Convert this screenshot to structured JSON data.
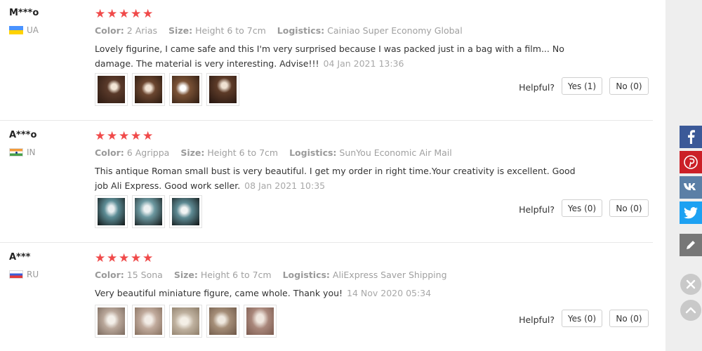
{
  "reviews": [
    {
      "user": "M***o",
      "country": "UA",
      "rating": 5,
      "color_label": "Color:",
      "color": "2 Arias",
      "size_label": "Size:",
      "size": "Height 6 to 7cm",
      "logistics_label": "Logistics:",
      "logistics": "Cainiao Super Economy Global",
      "text": "Lovely figurine, I came safe and this I'm very surprised because I was packed just in a bag with a film... No damage. The material is very interesting. Advise!!!",
      "date": "04 Jan 2021 13:36",
      "photos": 4,
      "helpful_label": "Helpful?",
      "yes": "Yes (1)",
      "no": "No (0)"
    },
    {
      "user": "A***o",
      "country": "IN",
      "rating": 5,
      "color_label": "Color:",
      "color": "6 Agrippa",
      "size_label": "Size:",
      "size": "Height 6 to 7cm",
      "logistics_label": "Logistics:",
      "logistics": "SunYou Economic Air Mail",
      "text": "This antique Roman small bust is very beautiful. I get my order in right time.Your creativity is excellent. Good job Ali Express. Good work seller.",
      "date": "08 Jan 2021 10:35",
      "photos": 3,
      "helpful_label": "Helpful?",
      "yes": "Yes (0)",
      "no": "No (0)"
    },
    {
      "user": "A***",
      "country": "RU",
      "rating": 5,
      "color_label": "Color:",
      "color": "15 Sona",
      "size_label": "Size:",
      "size": "Height 6 to 7cm",
      "logistics_label": "Logistics:",
      "logistics": "AliExpress Saver Shipping",
      "text": "Very beautiful miniature figure, came whole. Thank you!",
      "date": "14 Nov 2020 05:34",
      "photos": 5,
      "helpful_label": "Helpful?",
      "yes": "Yes (0)",
      "no": "No (0)"
    }
  ],
  "share_icons": [
    "facebook-icon",
    "pinterest-icon",
    "vk-icon",
    "twitter-icon",
    "pencil-icon"
  ],
  "colors": {
    "star": "#f04a4a",
    "facebook": "#3b5998",
    "pinterest": "#cb2027",
    "vk": "#5b7fa6",
    "twitter": "#1da1f2"
  }
}
